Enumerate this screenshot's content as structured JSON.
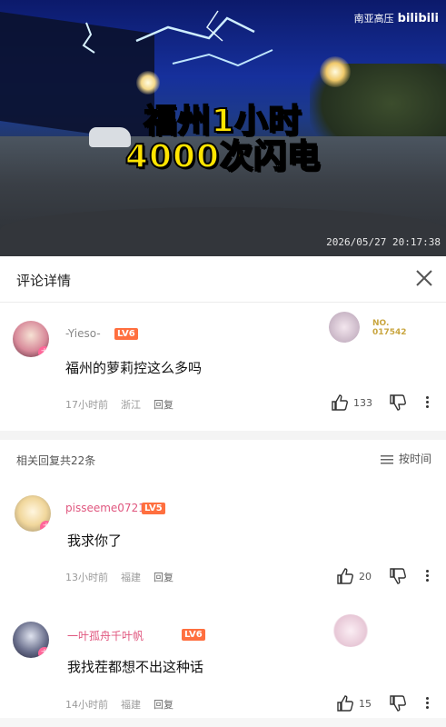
{
  "video": {
    "caption_line1": "福州1小时",
    "caption_line2": "4000次闪电",
    "watermark_channel": "南亚高压",
    "watermark_logo": "bilibili",
    "timestamp": "2026/05/27 20:17:38"
  },
  "header": {
    "title": "评论详情"
  },
  "main_comment": {
    "username": "-Yieso-",
    "level": "LV6",
    "fan_number": "NO.\n017542",
    "text": "福州的萝莉控这么多吗",
    "time": "17小时前",
    "location": "浙江",
    "reply_label": "回复",
    "likes": "133"
  },
  "related": {
    "label": "相关回复共22条",
    "sort_label": "按时间"
  },
  "replies": [
    {
      "username": "pisseeme0721",
      "level": "LV5",
      "text": "我求你了",
      "time": "13小时前",
      "location": "福建",
      "reply_label": "回复",
      "likes": "20"
    },
    {
      "username": "一叶孤舟千叶帆",
      "level": "LV6",
      "text": "我找茬都想不出这种话",
      "time": "14小时前",
      "location": "福建",
      "reply_label": "回复",
      "likes": "15"
    }
  ],
  "colors": {
    "caption": "#ffe400",
    "level_badge": "#ff6f3f",
    "avatar_badge": "#ff6699"
  }
}
